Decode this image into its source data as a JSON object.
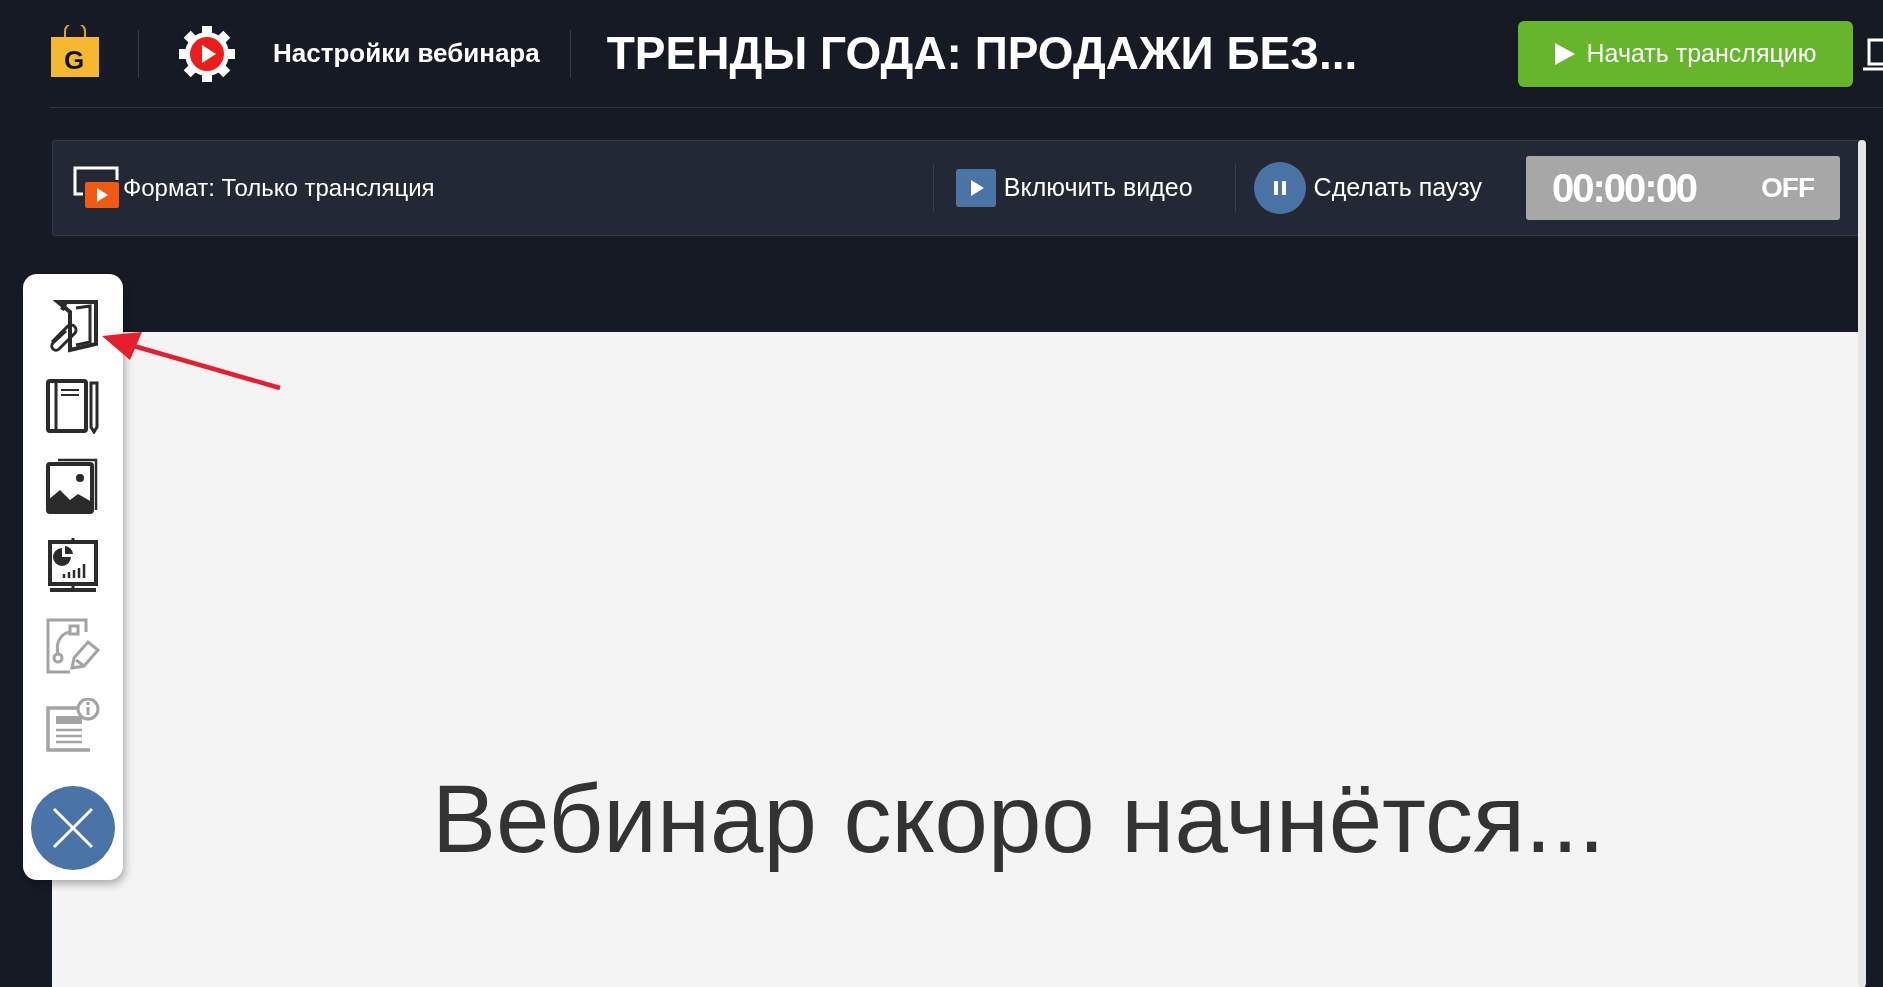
{
  "header": {
    "logo": "G",
    "app_title": "Настройки вебинара",
    "webinar_title": "ТРЕНДЫ ГОДА: ПРОДАЖИ БЕЗ...",
    "start_button": "Начать трансляцию"
  },
  "broadcast_bar": {
    "format": "Формат: Только трансляция",
    "video_button": "Включить видео",
    "pause_button": "Сделать паузу",
    "timer": "00:00:00",
    "timer_state": "OFF"
  },
  "tools": [
    {
      "kind": "attachments",
      "disabled": false
    },
    {
      "kind": "notes",
      "disabled": false
    },
    {
      "kind": "images",
      "disabled": false
    },
    {
      "kind": "presentation",
      "disabled": false
    },
    {
      "kind": "drawing",
      "disabled": true
    },
    {
      "kind": "info",
      "disabled": true
    }
  ],
  "stage": {
    "message": "Вебинар скоро начнётся..."
  }
}
